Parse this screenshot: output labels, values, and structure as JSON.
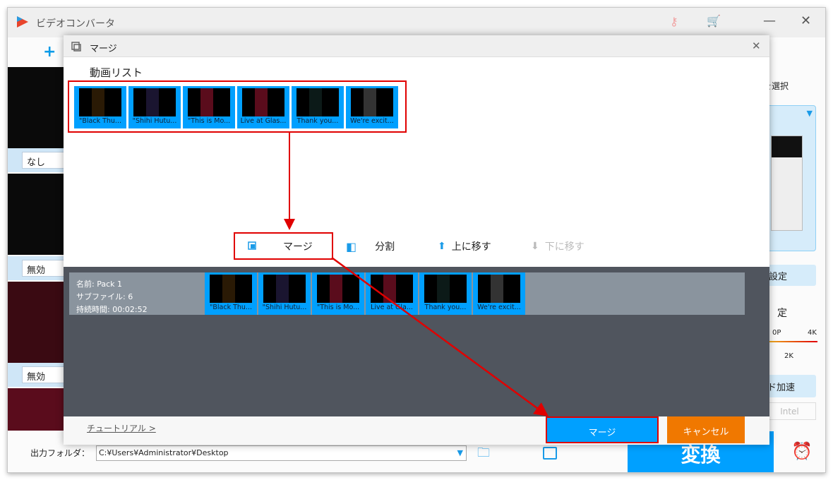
{
  "app": {
    "title": "ビデオコンバータ",
    "left_subtitles": [
      "なし",
      "無効",
      "無効"
    ],
    "add_label": "+"
  },
  "right": {
    "format_label": "を選択",
    "settings_btn": "設定",
    "quality_label": "定",
    "slider": {
      "left": "0P",
      "right": "4K",
      "mid": "2K"
    },
    "accel_btn": "ド加速",
    "intel": "Intel"
  },
  "bottom": {
    "output_label": "出力フォルダ：",
    "output_path": "C:¥Users¥Administrator¥Desktop",
    "convert": "変換"
  },
  "dialog": {
    "title": "マージ",
    "list_title": "動画リスト",
    "videos": [
      "\"Black Thu...",
      "\"Shihi Hutu...",
      "\"This is Mo...",
      "Live at Glas...",
      "Thank you...",
      "We're excit..."
    ],
    "toolbar": {
      "merge": "マージ",
      "split": "分割",
      "up": "上に移す",
      "down": "下に移す"
    },
    "pack": {
      "name": "名前: Pack 1",
      "subfiles": "サブファイル: 6",
      "duration": "持続時間: 00:02:52",
      "videos": [
        "\"Black Thu...",
        "\"Shihi Hutu...",
        "\"This is Mo...",
        "Live at Gla...",
        "Thank you...",
        "We're excit..."
      ]
    },
    "tutorial": "チュートリアル >",
    "merge_btn": "マージ",
    "cancel_btn": "キャンセル"
  },
  "colors": {
    "accent": "#00a0ff",
    "cancel": "#f07800",
    "highlight": "#e00000"
  }
}
